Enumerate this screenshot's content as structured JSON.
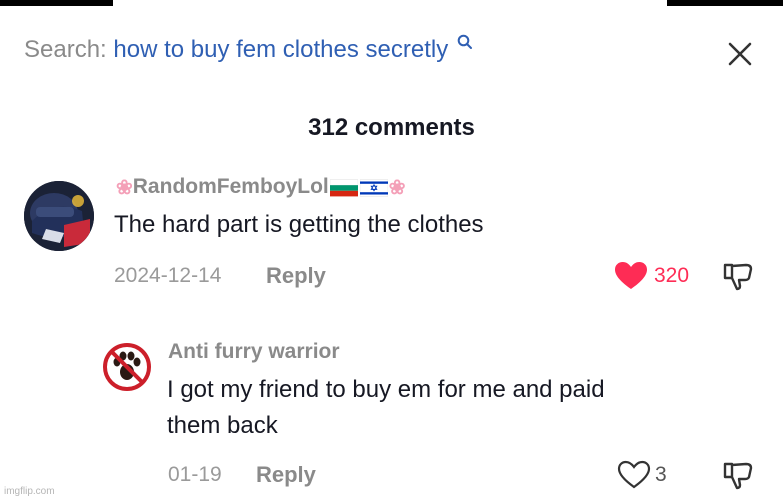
{
  "search": {
    "label": "Search:",
    "query": "how to buy fem clothes secretly"
  },
  "comments_count": "312 comments",
  "comments": [
    {
      "username": "RandomFemboyLol",
      "text": "The hard part is getting the clothes",
      "date": "2024-12-14",
      "reply_label": "Reply",
      "likes": "320",
      "liked": true
    },
    {
      "username": "Anti furry warrior",
      "text_line1": "I got my friend to buy em for me and paid",
      "text_line2": "them back",
      "date": "01-19",
      "reply_label": "Reply",
      "likes": "3",
      "liked": false
    }
  ],
  "watermark": "imgflip.com",
  "colors": {
    "accent_blue": "#2f5fb3",
    "like_red": "#fe2c55",
    "muted": "#8a8a8a",
    "text": "#161823"
  },
  "icons": [
    "search-icon",
    "close-icon",
    "heart-filled-icon",
    "heart-outline-icon",
    "dislike-icon",
    "bulgaria-flag-icon",
    "israel-flag-icon",
    "cherry-blossom-icon"
  ]
}
